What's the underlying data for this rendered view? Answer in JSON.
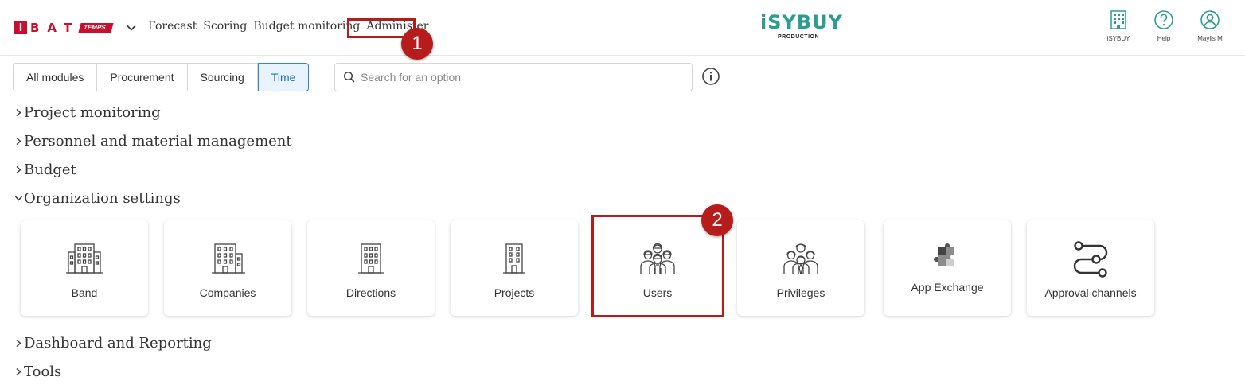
{
  "header": {
    "logo_i": "i",
    "logo_letters": "BAT",
    "logo_temps": "TEMPS",
    "nav": [
      "Forecast",
      "Scoring",
      "Budget monitoring",
      "Administer"
    ],
    "brand_name": "iSYBUY",
    "brand_sub": "PRODUCTION",
    "right": [
      {
        "label": "iSYBUY",
        "icon": "building-icon"
      },
      {
        "label": "Help",
        "icon": "help-circle-icon"
      },
      {
        "label": "Maylis M",
        "icon": "user-circle-icon"
      }
    ]
  },
  "modules": {
    "tabs": [
      "All modules",
      "Procurement",
      "Sourcing",
      "Time"
    ],
    "active": "Time",
    "search_placeholder": "Search for an option"
  },
  "sections": [
    "Project monitoring",
    "Personnel and material management",
    "Budget",
    "Organization settings",
    "Dashboard and Reporting",
    "Tools"
  ],
  "cards": [
    "Band",
    "Companies",
    "Directions",
    "Projects",
    "Users",
    "Privileges",
    "App Exchange",
    "Approval channels"
  ],
  "annotations": {
    "step1": "1",
    "step2": "2",
    "color": "#b71c1c"
  },
  "colors": {
    "brand": "#2a9d8f",
    "logo": "#c8102e",
    "active_tab": "#2f86d6"
  }
}
